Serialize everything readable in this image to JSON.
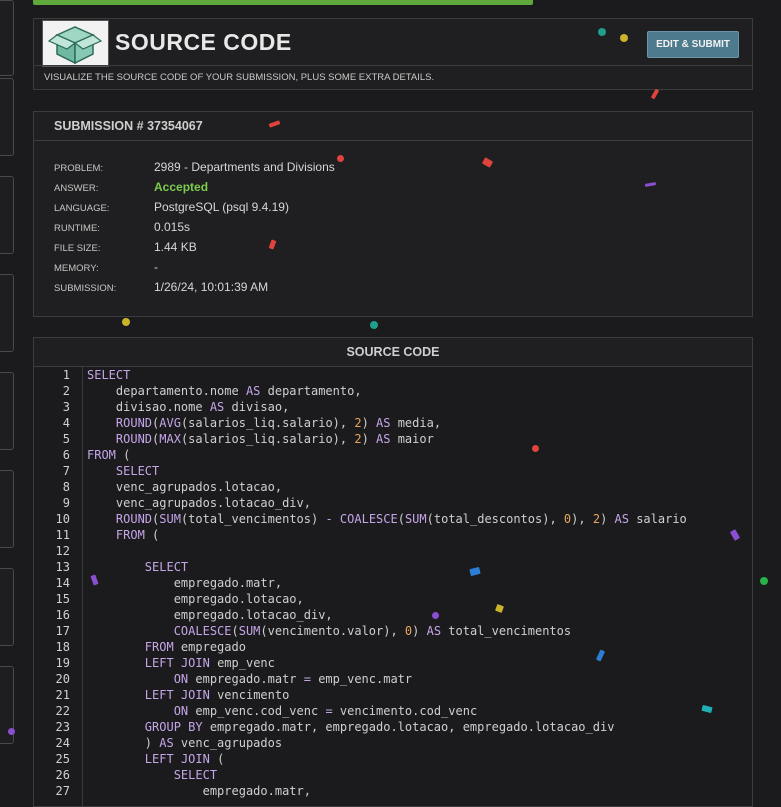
{
  "header": {
    "title": "SOURCE CODE",
    "edit_label": "EDIT & SUBMIT",
    "subtitle": "VISUALIZE THE SOURCE CODE OF YOUR SUBMISSION, PLUS SOME EXTRA DETAILS."
  },
  "submission": {
    "title": "SUBMISSION # 37354067",
    "problem_label": "PROBLEM:",
    "problem": "2989 - Departments and Divisions",
    "answer_label": "ANSWER:",
    "answer": "Accepted",
    "language_label": "LANGUAGE:",
    "language": "PostgreSQL (psql 9.4.19)",
    "runtime_label": "RUNTIME:",
    "runtime": "0.015s",
    "filesize_label": "FILE SIZE:",
    "filesize": "1.44 KB",
    "memory_label": "MEMORY:",
    "memory": "-",
    "submission_label": "SUBMISSION:",
    "submission_time": "1/26/24, 10:01:39 AM"
  },
  "code": {
    "title": "SOURCE CODE",
    "lines": [
      "SELECT",
      "    departamento.nome AS departamento,",
      "    divisao.nome AS divisao,",
      "    ROUND(AVG(salarios_liq.salario), 2) AS media,",
      "    ROUND(MAX(salarios_liq.salario), 2) AS maior",
      "FROM (",
      "    SELECT",
      "    venc_agrupados.lotacao,",
      "    venc_agrupados.lotacao_div,",
      "    ROUND(SUM(total_vencimentos) - COALESCE(SUM(total_descontos), 0), 2) AS salario",
      "    FROM (",
      "",
      "        SELECT",
      "            empregado.matr,",
      "            empregado.lotacao,",
      "            empregado.lotacao_div,",
      "            COALESCE(SUM(vencimento.valor), 0) AS total_vencimentos",
      "        FROM empregado",
      "        LEFT JOIN emp_venc",
      "            ON empregado.matr = emp_venc.matr",
      "        LEFT JOIN vencimento",
      "            ON emp_venc.cod_venc = vencimento.cod_venc",
      "        GROUP BY empregado.matr, empregado.lotacao, empregado.lotacao_div",
      "        ) AS venc_agrupados",
      "        LEFT JOIN (",
      "            SELECT",
      "                empregado.matr,"
    ]
  },
  "colors": {
    "accent": "#5fa83c",
    "accepted": "#7ccb4d",
    "button": "#4d7a8c",
    "keyword": "#c5a5e8",
    "number": "#e6a65a"
  }
}
